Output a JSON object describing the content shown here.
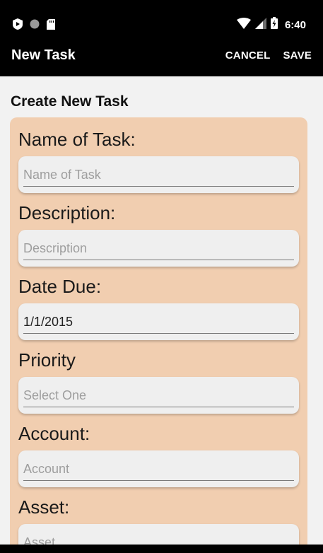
{
  "status_bar": {
    "time": "6:40",
    "left_icons": [
      "play-shield-icon",
      "circle-icon",
      "sd-card-icon"
    ],
    "right_icons": [
      "wifi-icon",
      "signal-icon",
      "battery-charging-icon"
    ]
  },
  "app_bar": {
    "title": "New Task",
    "cancel_label": "CANCEL",
    "save_label": "SAVE"
  },
  "form": {
    "section_title": "Create New Task",
    "card_color": "#f1ceb0",
    "fields": [
      {
        "label": "Name of Task:",
        "placeholder": "Name of Task",
        "value": ""
      },
      {
        "label": "Description:",
        "placeholder": "Description",
        "value": ""
      },
      {
        "label": "Date Due:",
        "placeholder": "",
        "value": "1/1/2015"
      },
      {
        "label": "Priority",
        "placeholder": "Select One",
        "value": ""
      },
      {
        "label": "Account:",
        "placeholder": "Account",
        "value": ""
      },
      {
        "label": "Asset:",
        "placeholder": "Asset",
        "value": ""
      }
    ]
  }
}
